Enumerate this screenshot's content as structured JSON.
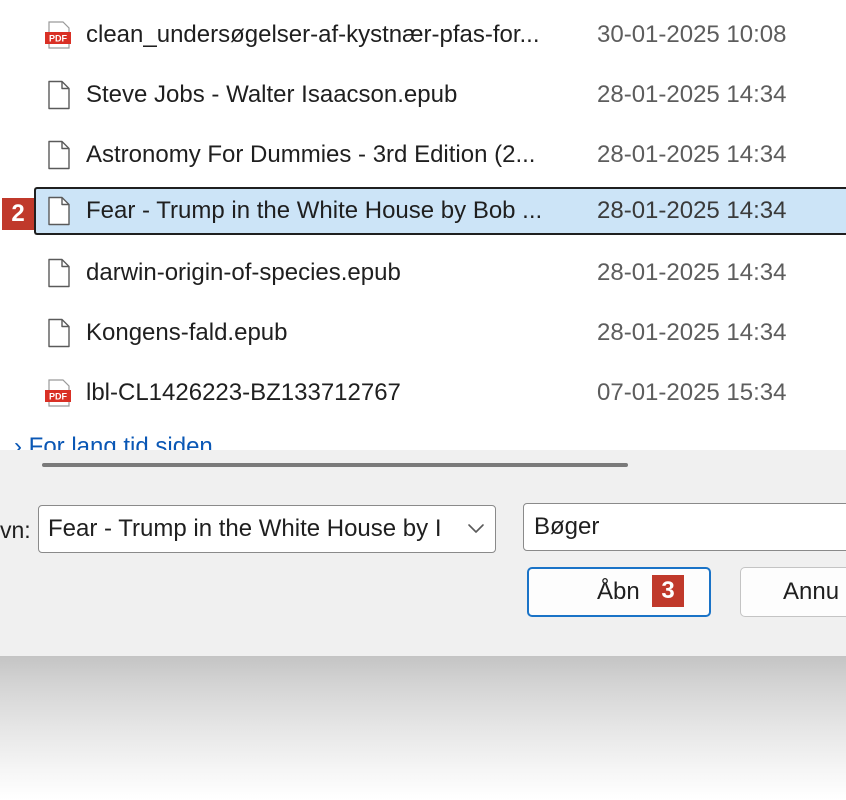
{
  "files": [
    {
      "name": "clean_undersøgelser-af-kystnær-pfas-for...",
      "date": "30-01-2025 10:08",
      "icon": "pdf-file-icon",
      "selected": false
    },
    {
      "name": "Steve Jobs - Walter Isaacson.epub",
      "date": "28-01-2025 14:34",
      "icon": "blank-file-icon",
      "selected": false
    },
    {
      "name": "Astronomy For Dummies - 3rd Edition (2...",
      "date": "28-01-2025 14:34",
      "icon": "blank-file-icon",
      "selected": false
    },
    {
      "name": "Fear - Trump in the White House by Bob ...",
      "date": "28-01-2025 14:34",
      "icon": "blank-file-icon",
      "selected": true
    },
    {
      "name": "darwin-origin-of-species.epub",
      "date": "28-01-2025 14:34",
      "icon": "blank-file-icon",
      "selected": false
    },
    {
      "name": "Kongens-fald.epub",
      "date": "28-01-2025 14:34",
      "icon": "blank-file-icon",
      "selected": false
    },
    {
      "name": "lbl-CL1426223-BZ133712767",
      "date": "07-01-2025 15:34",
      "icon": "pdf-file-icon",
      "selected": false
    }
  ],
  "group_header": "› For lang tid siden",
  "filename": {
    "label": "vn:",
    "value": "Fear - Trump in the White House by I"
  },
  "filetype": {
    "value": "Bøger"
  },
  "buttons": {
    "open": "Åbn",
    "cancel": "Annu"
  },
  "badges": {
    "selected_file": "2",
    "open_button": "3"
  },
  "colors": {
    "selection": "#cce4f7",
    "badge": "#c0392b",
    "primary_border": "#1a73c7",
    "pdf_red": "#d93025"
  }
}
